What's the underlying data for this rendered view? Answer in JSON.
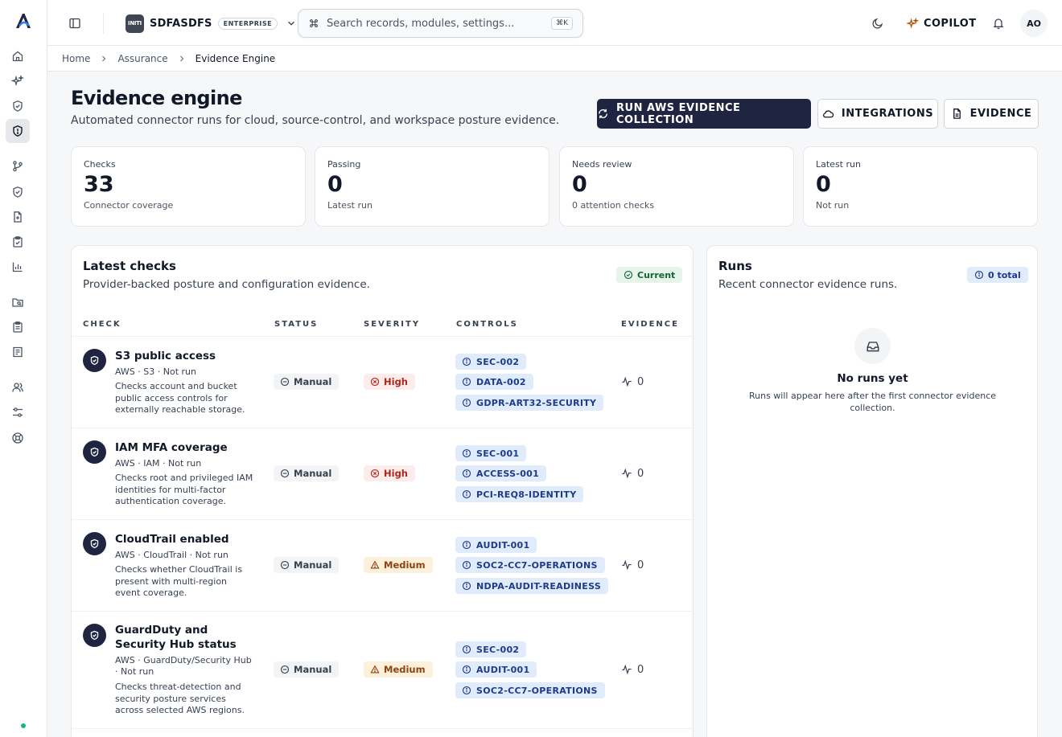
{
  "topbar": {
    "org_badge": "INITI",
    "org_name": "SDFASDFS",
    "org_plan": "ENTERPRISE",
    "search_placeholder": "Search records, modules, settings...",
    "search_shortcut": "⌘K",
    "copilot_label": "COPILOT",
    "avatar_initials": "AO"
  },
  "breadcrumb": [
    "Home",
    "Assurance",
    "Evidence Engine"
  ],
  "header": {
    "title": "Evidence engine",
    "subtitle": "Automated connector runs for cloud, source-control, and workspace posture evidence.",
    "primary_button": "RUN AWS EVIDENCE COLLECTION",
    "integrations_button": "INTEGRATIONS",
    "evidence_button": "EVIDENCE"
  },
  "stats": [
    {
      "label": "Checks",
      "value": "33",
      "sub": "Connector coverage"
    },
    {
      "label": "Passing",
      "value": "0",
      "sub": "Latest run"
    },
    {
      "label": "Needs review",
      "value": "0",
      "sub": "0 attention checks"
    },
    {
      "label": "Latest run",
      "value": "0",
      "sub": "Not run"
    }
  ],
  "checks_panel": {
    "title": "Latest checks",
    "subtitle": "Provider-backed posture and configuration evidence.",
    "badge": "Current",
    "columns": [
      "CHECK",
      "STATUS",
      "SEVERITY",
      "CONTROLS",
      "EVIDENCE"
    ],
    "rows": [
      {
        "name": "S3 public access",
        "meta": "AWS · S3 · Not run",
        "desc": "Checks account and bucket public access controls for externally reachable storage.",
        "status": "Manual",
        "severity": "High",
        "controls": [
          "SEC-002",
          "DATA-002",
          "GDPR-ART32-SECURITY"
        ],
        "evidence": "0",
        "clipped": [
          "I",
          "S",
          "I"
        ]
      },
      {
        "name": "IAM MFA coverage",
        "meta": "AWS · IAM · Not run",
        "desc": "Checks root and privileged IAM identities for multi-factor authentication coverage.",
        "status": "Manual",
        "severity": "High",
        "controls": [
          "SEC-001",
          "ACCESS-001",
          "PCI-REQ8-IDENTITY"
        ],
        "evidence": "0",
        "clipped": [
          "I",
          "I",
          "I"
        ]
      },
      {
        "name": "CloudTrail enabled",
        "meta": "AWS · CloudTrail · Not run",
        "desc": "Checks whether CloudTrail is present with multi-region event coverage.",
        "status": "Manual",
        "severity": "Medium",
        "controls": [
          "AUDIT-001",
          "SOC2-CC7-OPERATIONS",
          "NDPA-AUDIT-READINESS"
        ],
        "evidence": "0",
        "clipped": [
          "I",
          "t",
          "I"
        ]
      },
      {
        "name": "GuardDuty and Security Hub status",
        "meta": "AWS · GuardDuty/Security Hub · Not run",
        "desc": "Checks threat-detection and security posture services across selected AWS regions.",
        "status": "Manual",
        "severity": "Medium",
        "controls": [
          "SEC-002",
          "AUDIT-001",
          "SOC2-CC7-OPERATIONS"
        ],
        "evidence": "0",
        "clipped": [
          "C",
          "c",
          "c"
        ]
      }
    ]
  },
  "runs_panel": {
    "title": "Runs",
    "subtitle": "Recent connector evidence runs.",
    "badge": "0 total",
    "empty_title": "No runs yet",
    "empty_sub": "Runs will appear here after the first connector evidence collection."
  },
  "colors": {
    "primary": "#1f2540",
    "high": "#b42318",
    "medium": "#92400e",
    "control": "#1e3a8a",
    "current": "#166534"
  }
}
